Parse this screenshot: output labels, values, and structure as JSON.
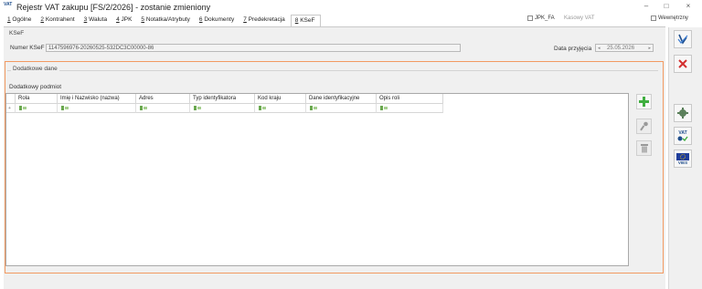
{
  "window": {
    "icon_label": "VAT",
    "title": "Rejestr VAT zakupu [FS/2/2026] - zostanie zmieniony",
    "minimize": "–",
    "maximize": "□",
    "close": "×"
  },
  "tabs": [
    {
      "key": "1",
      "label": " Ogólne"
    },
    {
      "key": "2",
      "label": " Kontrahent"
    },
    {
      "key": "3",
      "label": " Waluta"
    },
    {
      "key": "4",
      "label": " JPK"
    },
    {
      "key": "5",
      "label": " Notatka/Atrybuty"
    },
    {
      "key": "6",
      "label": " Dokumenty"
    },
    {
      "key": "7",
      "label": " Predekretacja"
    },
    {
      "key": "8",
      "label": " KSeF"
    }
  ],
  "checkboxes": {
    "jpk_fa": "JPK_FA",
    "kasowy_vat": "Kasowy VAT",
    "wewnetrzny": "Wewnętrzny"
  },
  "ksef": {
    "group_label": "KSeF",
    "numer_label": "Numer KSeF",
    "numer_value": "1147596976-20260525-532DC3C00000-86",
    "data_label": "Data przyjęcia",
    "data_value": "25.05.2026"
  },
  "dodatkowe": {
    "group_label": "Dodatkowe dane",
    "podmiot_label": "Dodatkowy podmiot",
    "columns": [
      "Rola",
      "Imię i Nazwisko (nazwa)",
      "Adres",
      "Typ identyfikatora",
      "Kod kraju",
      "Dane identyfikacyjne",
      "Opis roli"
    ]
  },
  "side_icons": {
    "add": "plus-icon",
    "edit": "edit-icon",
    "delete": "trash-icon"
  },
  "right_panel": {
    "save_icon": "save-icon",
    "cancel_icon": "close-icon",
    "vat_label": "VAT",
    "vies_label": "VIES"
  },
  "colors": {
    "accent_frame": "#f29a61",
    "add_green": "#3fae3f",
    "cancel_red": "#d32f2f"
  }
}
